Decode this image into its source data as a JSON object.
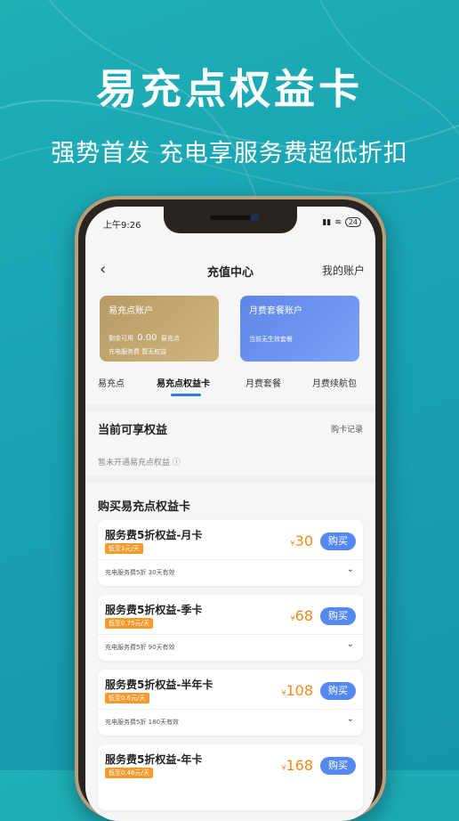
{
  "headline": "易充点权益卡",
  "subhead": "强势首发 充电享服务费超低折扣",
  "status": {
    "time": "上午9:26",
    "battery": "24"
  },
  "nav": {
    "title": "充值中心",
    "right": "我的账户",
    "back_icon": "chevron-left-icon"
  },
  "cards": {
    "gold": {
      "title": "易充点账户",
      "line1_label": "剩余可用",
      "line1_value": "0.00",
      "line1_unit": "易充点",
      "line2": "充电服务费 暂无权益"
    },
    "blue": {
      "title": "月费套餐账户",
      "line1": "当前无生效套餐"
    }
  },
  "tabs": [
    "易充点",
    "易充点权益卡",
    "月费套餐",
    "月费续航包"
  ],
  "current": {
    "title": "当前可享权益",
    "record": "购卡记录",
    "empty": "暂未开通易充点权益"
  },
  "buy_title": "购买易充点权益卡",
  "products": [
    {
      "title": "服务费5折权益-月卡",
      "badge": "低至1元/天",
      "price": "30",
      "buy": "购买",
      "desc": "充电服务费5折   30天有效"
    },
    {
      "title": "服务费5折权益-季卡",
      "badge": "低至0.75元/天",
      "price": "68",
      "buy": "购买",
      "desc": "充电服务费5折   90天有效"
    },
    {
      "title": "服务费5折权益-半年卡",
      "badge": "低至0.6元/天",
      "price": "108",
      "buy": "购买",
      "desc": "充电服务费5折   180天有效"
    },
    {
      "title": "服务费5折权益-年卡",
      "badge": "低至0.46元/天",
      "price": "168",
      "buy": "购买",
      "desc": ""
    }
  ],
  "currency": "¥",
  "colors": {
    "accent": "#2a7be8",
    "price": "#f08a1a",
    "badge": "#f59a2d",
    "bg": "#1fb0b8"
  }
}
